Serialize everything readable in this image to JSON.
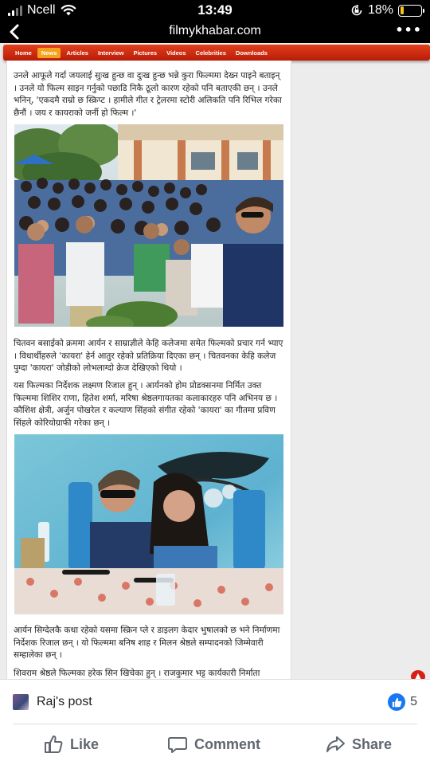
{
  "status_bar": {
    "carrier": "Ncell",
    "time": "13:49",
    "battery_percent": "18%",
    "battery_level": 0.18,
    "battery_color": "#f5c518"
  },
  "browser": {
    "url": "filmykhabar.com",
    "back_icon": "chevron-left-icon",
    "more_icon": "more-dots-icon"
  },
  "site_nav": {
    "items": [
      "Home",
      "News",
      "Articles",
      "Interview",
      "Pictures",
      "Videos",
      "Celebrities",
      "Downloads"
    ],
    "active": "News",
    "bar_color": "#c92a10",
    "active_color": "#f4a21d"
  },
  "article": {
    "paragraphs": [
      "उनले आफूले गर्दा जयलाई सुःख हुन्छ वा दुःख हुन्छ भन्ने कुरा फिल्ममा देख्न पाइने बताइन् । उनले यो फिल्म साइन गर्नुको पछाडि निकै ठूलो कारण रहेको पनि बताएकी छन् । उनले भनिन्, 'एकदमै राम्रो छ स्क्रिप्ट । हामीले गीत र ट्रेलरमा स्टोरी अलिकति पनि रिभिल गरेका छैनौं । जय र कायराको जर्नी हो फिल्म ।'",
      "चितवन बसाईको क्रममा आर्यन र साम्राज्ञीले केहि कलेजमा समेत फिल्मको प्रचार गर्न भ्याए । विधार्थीहरुले 'कायरा' हेर्न आतुर रहेको प्रतिक्रिया दिएका छन् । चितवनका केहि कलेज पुग्दा 'कायरा' जोडीको लोभलाग्दो क्रेज देखिएको थियो ।",
      "यस फिल्मका निर्देशक लक्ष्मण रिजाल हुन् । आर्यनको होम प्रोडक्सनमा निर्मित उक्त फिल्ममा शिशिर राणा, हितेश शर्मा, मरिषा श्रेष्ठलगायतका कलाकारहरु पनि अभिनय छ । कौशिश क्षेत्री, अर्जुन पोखरेल र कल्याण सिंहको संगीत रहेको 'कायरा' का गीतमा प्रविण सिंहले कोरियोग्राफी गरेका छन् ।",
      "आर्यन सिग्देलकै कथा रहेको यसमा स्क्रिन प्ले र डाइलग केदार भुषालको छ भने निर्माणमा निर्देशक रिजाल छन् । यो फिल्ममा बनिष शाह र मिलन श्रेष्ठले सम्पादनको जिम्मेवारी सम्हालेका छन् ।",
      "शिवराम श्रेष्ठले फिल्मका हरेक सिन खिचेका हुन् । राजकुमार भट्ट कार्यकारी निर्माता"
    ]
  },
  "scroll_top_icon": "arrow-up-icon",
  "fb_bar": {
    "post_title": "Raj's post",
    "like_count": "5",
    "like_label": "Like",
    "comment_label": "Comment",
    "share_label": "Share",
    "accent": "#1877f2"
  }
}
